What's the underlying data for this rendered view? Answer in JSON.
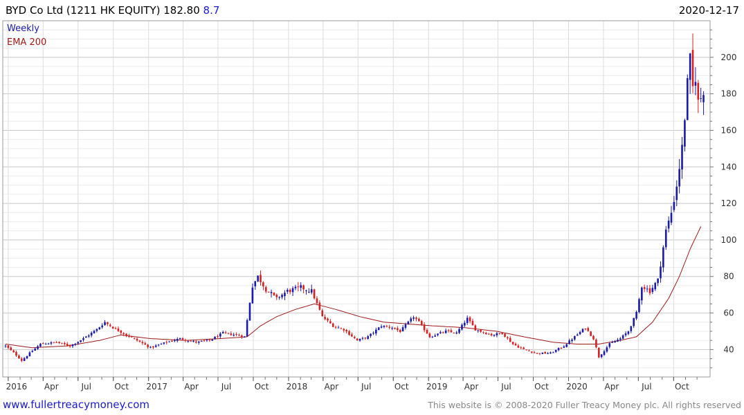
{
  "header": {
    "name": "BYD Co Ltd",
    "ticker": "(1211 HK EQUITY)",
    "price": "182.80",
    "change": "8.7",
    "date": "2020-12-17"
  },
  "legend": {
    "weekly": "Weekly",
    "ema": "EMA 200"
  },
  "footer": {
    "site": "www.fullertreacymoney.com",
    "copyright": "This website is © 2008-2020 Fuller Treacy Money plc. All rights reserved"
  },
  "colors": {
    "up": "#1a1aa8",
    "down": "#d42020",
    "ema": "#a01818",
    "grid": "#d6d6d6",
    "change": "#1a1acc",
    "link": "#1a1acc",
    "copyright": "#888888"
  },
  "chart_data": {
    "type": "candlestick",
    "frequency": "weekly",
    "ylim": [
      25,
      220
    ],
    "yticks": [
      40,
      60,
      80,
      100,
      120,
      140,
      160,
      180,
      200
    ],
    "xticks": [
      {
        "label": "2016",
        "date": "2016-01-01"
      },
      {
        "label": "Apr",
        "date": "2016-04-01"
      },
      {
        "label": "Jul",
        "date": "2016-07-01"
      },
      {
        "label": "Oct",
        "date": "2016-10-01"
      },
      {
        "label": "2017",
        "date": "2017-01-01"
      },
      {
        "label": "Apr",
        "date": "2017-04-01"
      },
      {
        "label": "Jul",
        "date": "2017-07-01"
      },
      {
        "label": "Oct",
        "date": "2017-10-01"
      },
      {
        "label": "2018",
        "date": "2018-01-01"
      },
      {
        "label": "Apr",
        "date": "2018-04-01"
      },
      {
        "label": "Jul",
        "date": "2018-07-01"
      },
      {
        "label": "Oct",
        "date": "2018-10-01"
      },
      {
        "label": "2019",
        "date": "2019-01-01"
      },
      {
        "label": "Apr",
        "date": "2019-04-01"
      },
      {
        "label": "Jul",
        "date": "2019-07-01"
      },
      {
        "label": "Oct",
        "date": "2019-10-01"
      },
      {
        "label": "2020",
        "date": "2020-01-01"
      },
      {
        "label": "Apr",
        "date": "2020-04-01"
      },
      {
        "label": "Jul",
        "date": "2020-07-01"
      },
      {
        "label": "Oct",
        "date": "2020-10-01"
      }
    ],
    "date_range": [
      "2015-12-25",
      "2020-12-17"
    ],
    "close_anchors": [
      [
        "2015-12-25",
        42
      ],
      [
        "2016-01-22",
        37
      ],
      [
        "2016-02-05",
        34
      ],
      [
        "2016-02-26",
        38
      ],
      [
        "2016-03-25",
        43
      ],
      [
        "2016-05-06",
        44
      ],
      [
        "2016-06-10",
        42
      ],
      [
        "2016-07-15",
        46
      ],
      [
        "2016-08-19",
        51
      ],
      [
        "2016-09-09",
        55
      ],
      [
        "2016-09-30",
        52
      ],
      [
        "2016-11-04",
        48
      ],
      [
        "2016-12-02",
        45
      ],
      [
        "2017-01-06",
        41
      ],
      [
        "2017-02-17",
        44
      ],
      [
        "2017-03-24",
        46
      ],
      [
        "2017-05-05",
        44
      ],
      [
        "2017-06-09",
        45
      ],
      [
        "2017-07-14",
        49
      ],
      [
        "2017-08-18",
        48
      ],
      [
        "2017-09-08",
        47
      ],
      [
        "2017-09-15",
        56
      ],
      [
        "2017-09-22",
        66
      ],
      [
        "2017-09-29",
        75
      ],
      [
        "2017-10-13",
        80
      ],
      [
        "2017-11-03",
        73
      ],
      [
        "2017-12-01",
        68
      ],
      [
        "2017-12-29",
        72
      ],
      [
        "2018-02-02",
        74
      ],
      [
        "2018-03-02",
        72
      ],
      [
        "2018-03-16",
        65
      ],
      [
        "2018-03-30",
        58
      ],
      [
        "2018-04-27",
        53
      ],
      [
        "2018-05-25",
        51
      ],
      [
        "2018-06-29",
        45
      ],
      [
        "2018-07-27",
        47
      ],
      [
        "2018-08-31",
        53
      ],
      [
        "2018-09-28",
        52
      ],
      [
        "2018-10-19",
        50
      ],
      [
        "2018-11-23",
        58
      ],
      [
        "2018-12-07",
        55
      ],
      [
        "2019-01-04",
        47
      ],
      [
        "2019-02-15",
        50
      ],
      [
        "2019-03-15",
        49
      ],
      [
        "2019-04-12",
        57
      ],
      [
        "2019-05-03",
        51
      ],
      [
        "2019-06-14",
        48
      ],
      [
        "2019-07-12",
        49
      ],
      [
        "2019-08-09",
        43
      ],
      [
        "2019-09-06",
        40
      ],
      [
        "2019-10-11",
        38
      ],
      [
        "2019-11-15",
        38
      ],
      [
        "2019-12-20",
        42
      ],
      [
        "2020-01-17",
        47
      ],
      [
        "2020-02-14",
        52
      ],
      [
        "2020-03-06",
        46
      ],
      [
        "2020-03-20",
        36
      ],
      [
        "2020-04-17",
        43
      ],
      [
        "2020-05-15",
        46
      ],
      [
        "2020-06-05",
        50
      ],
      [
        "2020-06-26",
        60
      ],
      [
        "2020-07-10",
        75
      ],
      [
        "2020-07-31",
        72
      ],
      [
        "2020-08-21",
        78
      ],
      [
        "2020-09-11",
        105
      ],
      [
        "2020-09-25",
        115
      ],
      [
        "2020-10-09",
        130
      ],
      [
        "2020-10-23",
        150
      ],
      [
        "2020-11-06",
        185
      ],
      [
        "2020-11-13",
        198
      ],
      [
        "2020-11-20",
        183
      ],
      [
        "2020-11-27",
        190
      ],
      [
        "2020-12-04",
        175
      ],
      [
        "2020-12-11",
        178
      ],
      [
        "2020-12-17",
        182.8
      ]
    ],
    "ema_anchors": [
      [
        "2015-12-25",
        43
      ],
      [
        "2016-03-04",
        41
      ],
      [
        "2016-06-03",
        42
      ],
      [
        "2016-08-26",
        45
      ],
      [
        "2016-10-21",
        48
      ],
      [
        "2017-01-06",
        46
      ],
      [
        "2017-04-07",
        45
      ],
      [
        "2017-07-07",
        46
      ],
      [
        "2017-09-15",
        47
      ],
      [
        "2017-10-20",
        53
      ],
      [
        "2017-12-01",
        58
      ],
      [
        "2018-01-19",
        62
      ],
      [
        "2018-03-09",
        65
      ],
      [
        "2018-05-04",
        62
      ],
      [
        "2018-07-06",
        58
      ],
      [
        "2018-09-07",
        55
      ],
      [
        "2018-11-09",
        54
      ],
      [
        "2019-01-11",
        53
      ],
      [
        "2019-04-05",
        52
      ],
      [
        "2019-06-28",
        50
      ],
      [
        "2019-09-06",
        47
      ],
      [
        "2019-11-22",
        44
      ],
      [
        "2020-01-24",
        43
      ],
      [
        "2020-03-20",
        43
      ],
      [
        "2020-05-15",
        45
      ],
      [
        "2020-06-26",
        47
      ],
      [
        "2020-08-07",
        55
      ],
      [
        "2020-09-18",
        68
      ],
      [
        "2020-10-16",
        80
      ],
      [
        "2020-11-13",
        95
      ],
      [
        "2020-12-17",
        110
      ]
    ]
  }
}
